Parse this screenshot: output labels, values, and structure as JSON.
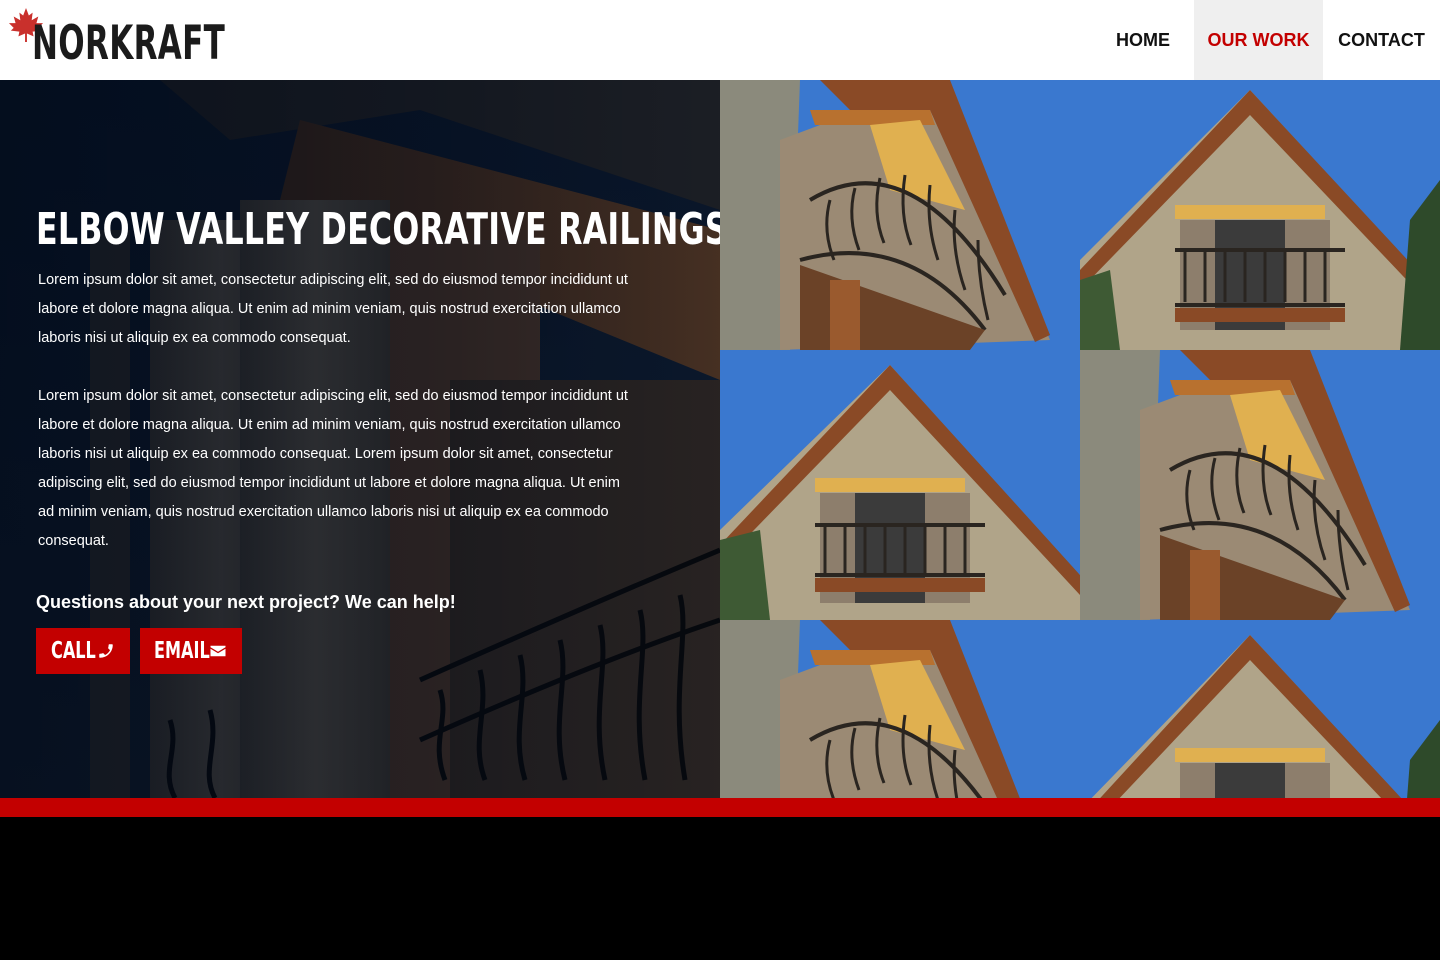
{
  "brand": {
    "name": "NORKRAFT",
    "logo_icon": "maple-leaf-icon",
    "leaf_color": "#c9302c"
  },
  "nav": {
    "items": [
      {
        "label": "HOME",
        "active": false
      },
      {
        "label": "OUR WORK",
        "active": true
      },
      {
        "label": "CONTACT",
        "active": false
      }
    ]
  },
  "hero": {
    "title": "ELBOW VALLEY DECORATIVE RAILINGS",
    "paragraph_1": "Lorem ipsum dolor sit amet, consectetur adipiscing elit, sed do eiusmod tempor incididunt ut labore et dolore magna aliqua. Ut enim ad minim veniam, quis nostrud exercitation ullamco laboris nisi ut aliquip ex ea commodo consequat.",
    "paragraph_2": "Lorem ipsum dolor sit amet, consectetur adipiscing elit, sed do eiusmod tempor incididunt ut labore et dolore magna aliqua. Ut enim ad minim veniam, quis nostrud exercitation ullamco laboris nisi ut aliquip ex ea commodo consequat. Lorem ipsum dolor sit amet, consectetur adipiscing elit, sed do eiusmod tempor incididunt ut labore et dolore magna aliqua. Ut enim ad minim veniam, quis nostrud exercitation ullamco laboris nisi ut aliquip ex ea commodo consequat.",
    "question": "Questions about your next project? We can help!",
    "call_label": "CALL",
    "call_icon": "phone-icon",
    "email_label": "EMAIL",
    "email_icon": "envelope-icon"
  },
  "gallery": {
    "photos": [
      {
        "view": "angled-left"
      },
      {
        "view": "front"
      },
      {
        "view": "front"
      },
      {
        "view": "angled-left"
      },
      {
        "view": "angled-left"
      },
      {
        "view": "front"
      }
    ]
  },
  "colors": {
    "accent": "#c30000",
    "header_bg": "#ffffff",
    "nav_active_bg": "#efefef",
    "footer_bg": "#000000"
  }
}
